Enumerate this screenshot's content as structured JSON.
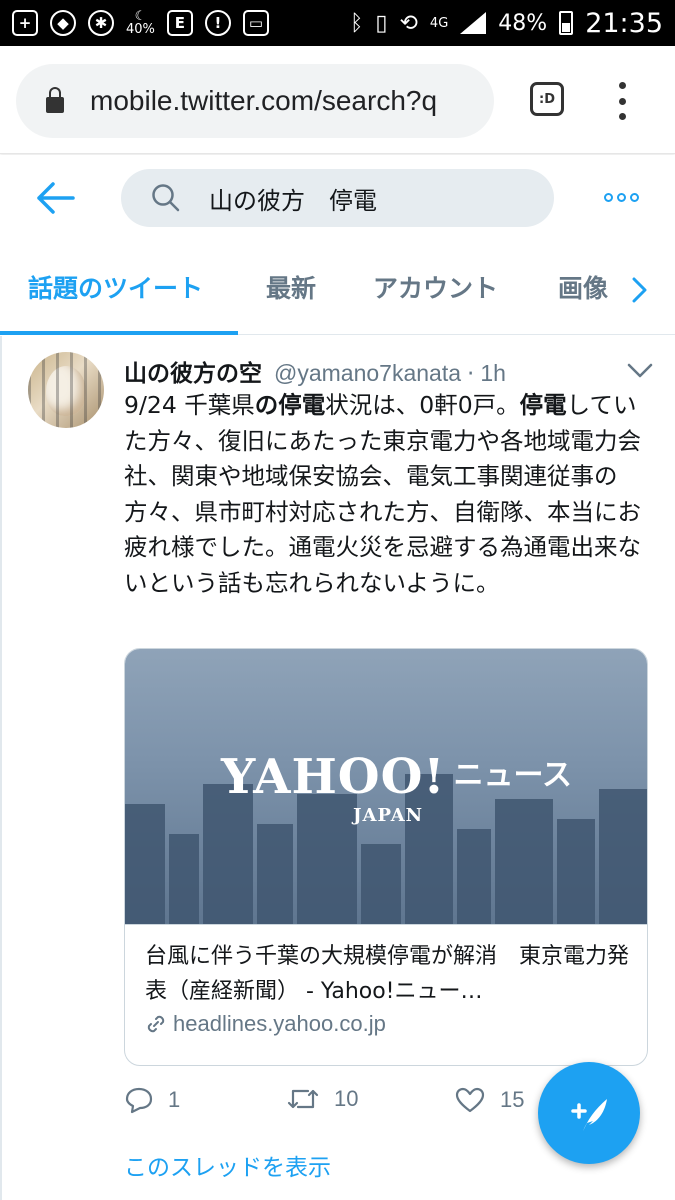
{
  "status_bar": {
    "battery_saver": "40%",
    "network": "4G",
    "battery_percent": "48%",
    "time": "21:35"
  },
  "browser": {
    "url": "mobile.twitter.com/search?q",
    "tab_button_label": ":D"
  },
  "twitter": {
    "search_query": "山の彼方　停電",
    "tabs": [
      {
        "label": "話題のツイート",
        "active": true
      },
      {
        "label": "最新",
        "active": false
      },
      {
        "label": "アカウント",
        "active": false
      },
      {
        "label": "画像",
        "active": false
      }
    ],
    "accent_color": "#1da1f2"
  },
  "tweet": {
    "author_name": "山の彼方の空",
    "author_handle": "@yamano7kanata",
    "separator": "·",
    "time": "1h",
    "text_segments": [
      {
        "text": "9/24 千葉県",
        "bold": false
      },
      {
        "text": "の停電",
        "bold": true
      },
      {
        "text": "状況は、0軒0戸。",
        "bold": false
      },
      {
        "text": "停電",
        "bold": true
      },
      {
        "text": "していた方々、復旧にあたった東京電力や各地域電力会社、関東や地域保安協会、電気工事関連従事の方々、県市町村対応された方、自衛隊、本当にお疲れ様でした。通電火災を忌避する為通電出来ないという話も忘れられないように。",
        "bold": false
      }
    ],
    "card": {
      "image_logo_main": "YAHOO!",
      "image_logo_sub": "JAPAN",
      "image_logo_suffix": "ニュース",
      "title": "台風に伴う千葉の大規模停電が解消　東京電力発表（産経新聞） - Yahoo!ニュー…",
      "domain": "headlines.yahoo.co.jp"
    },
    "actions": {
      "replies": "1",
      "retweets": "10",
      "likes": "15"
    },
    "show_thread": "このスレッドを表示"
  },
  "icons": [
    "back-arrow-icon",
    "search-icon",
    "more-icon",
    "chevron-right-icon",
    "caret-down-icon",
    "reply-icon",
    "retweet-icon",
    "like-icon",
    "link-icon",
    "compose-icon",
    "lock-icon",
    "kebab-icon"
  ]
}
